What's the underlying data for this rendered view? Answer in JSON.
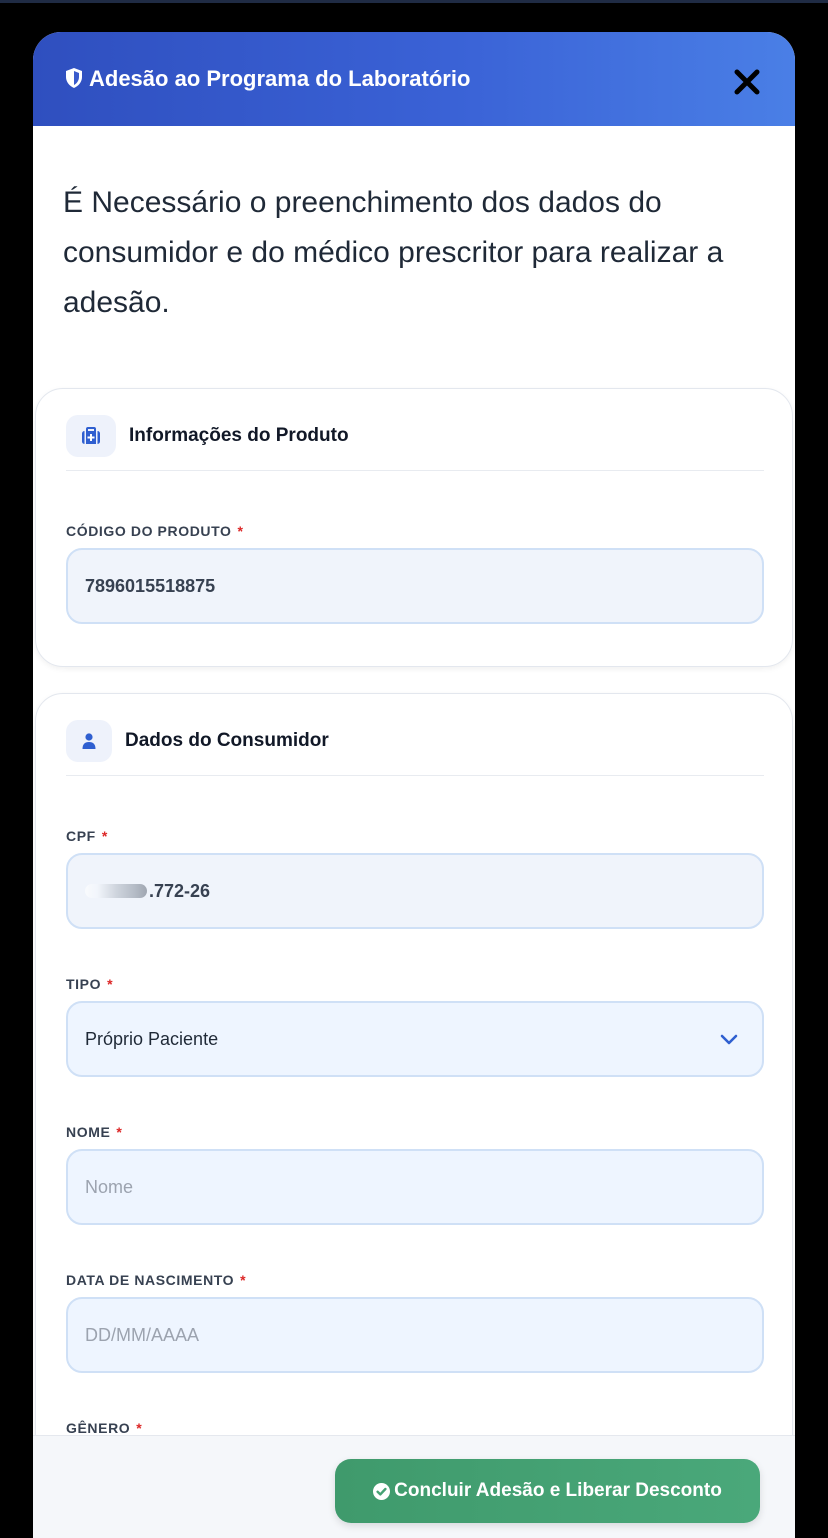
{
  "modal": {
    "title": "Adesão ao Programa do Laboratório",
    "intro": "É Necessário o preenchimento dos dados do consumidor e do médico prescritor para realizar a adesão."
  },
  "produto": {
    "section_title": "Informações do Produto",
    "codigo_label": "CÓDIGO DO PRODUTO",
    "codigo_value": "7896015518875"
  },
  "consumidor": {
    "section_title": "Dados do Consumidor",
    "cpf_label": "CPF",
    "cpf_value": ".772-26",
    "tipo_label": "TIPO",
    "tipo_value": "Próprio Paciente",
    "nome_label": "NOME",
    "nome_placeholder": "Nome",
    "nascimento_label": "DATA DE NASCIMENTO",
    "nascimento_placeholder": "DD/MM/AAAA",
    "genero_label": "GÊNERO"
  },
  "required_marker": "*",
  "footer": {
    "submit_label": "Concluir Adesão e Liberar Desconto"
  },
  "icons": {
    "header": "shield-icon",
    "close": "close-icon",
    "produto": "medical-kit-icon",
    "consumidor": "user-icon",
    "select": "chevron-down-icon",
    "submit": "check-circle-icon"
  },
  "colors": {
    "header_start": "#2f4fbf",
    "header_end": "#4a7fe6",
    "cta": "#4aa87a",
    "required": "#dc2626",
    "icon_accent": "#2f5fd0"
  }
}
